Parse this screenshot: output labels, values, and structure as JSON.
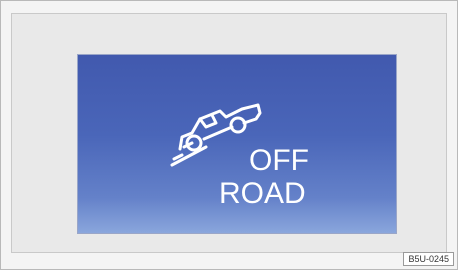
{
  "display": {
    "indicator_icon": "off-road-vehicle-on-slope-icon",
    "line1": "OFF",
    "line2": "ROAD",
    "background_color": "#4a66b9",
    "text_color": "#ffffff"
  },
  "figure": {
    "reference_code": "B5U-0245"
  }
}
